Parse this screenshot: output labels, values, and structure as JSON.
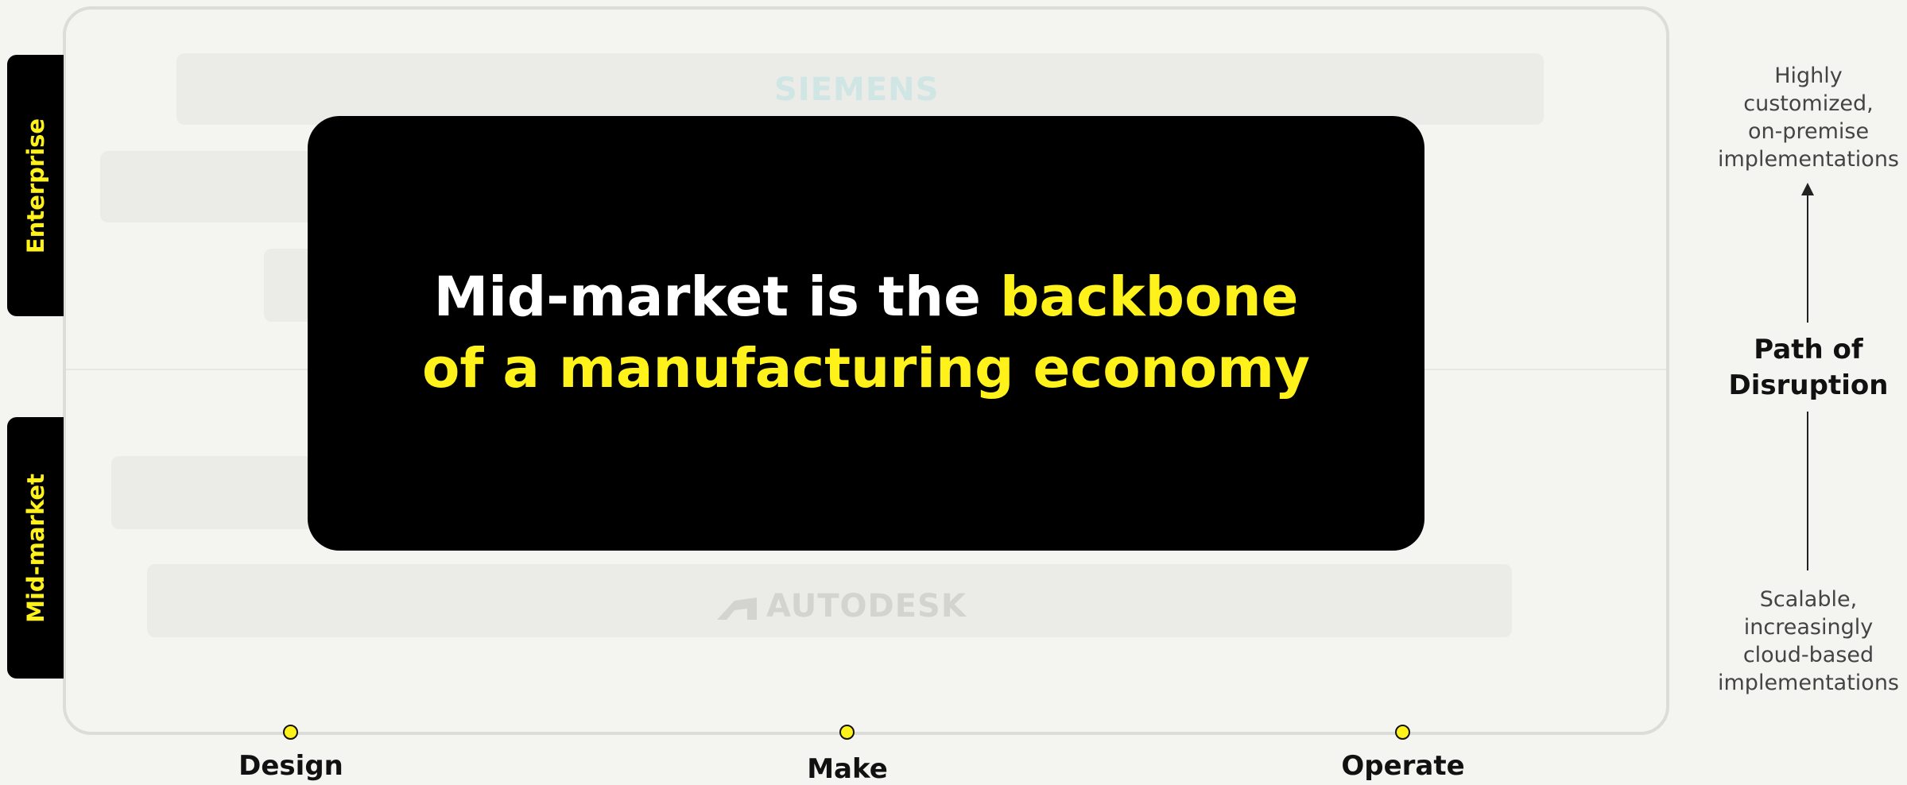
{
  "segments": {
    "enterprise": "Enterprise",
    "mid_market": "Mid-market"
  },
  "logos": {
    "top": "SIEMENS",
    "bottom": "AUTODESK"
  },
  "headline": {
    "white": "Mid-market is the ",
    "yellow_1": "backbone",
    "yellow_2": "of a manufacturing economy"
  },
  "stages": [
    "Design",
    "Make",
    "Operate"
  ],
  "path": {
    "top_note": [
      "Highly",
      "customized,",
      "on-premise",
      "implementations"
    ],
    "title": [
      "Path of",
      "Disruption"
    ],
    "bottom_note": [
      "Scalable,",
      "increasingly",
      "cloud-based",
      "implementations"
    ]
  },
  "colors": {
    "accent": "#fff21a",
    "overlay": "#000000",
    "background": "#f4f4f0"
  }
}
